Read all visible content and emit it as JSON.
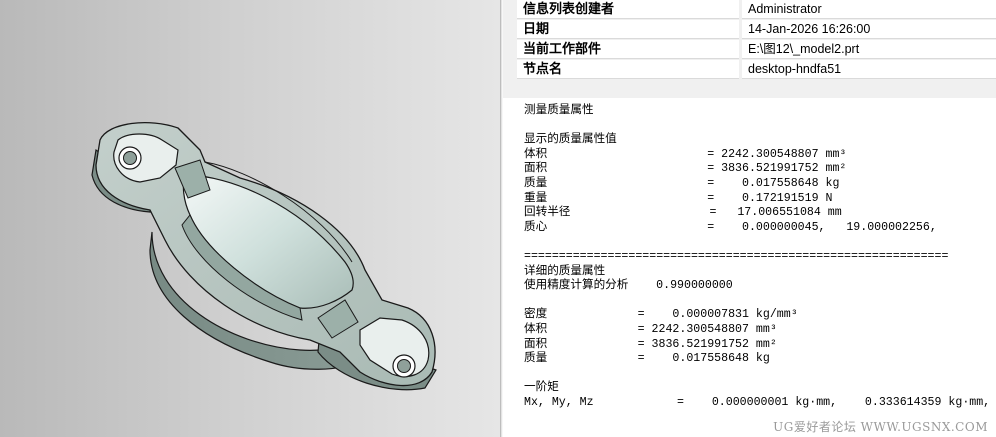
{
  "info_table": [
    {
      "key": "信息列表创建者",
      "value": "Administrator"
    },
    {
      "key": "日期",
      "value": "14-Jan-2026 16:26:00"
    },
    {
      "key": "当前工作部件",
      "value": "E:\\图12\\_model2.prt"
    },
    {
      "key": "节点名",
      "value": "desktop-hndfa51"
    }
  ],
  "report_lines": [
    "测量质量属性",
    "",
    "显示的质量属性值",
    "体积                       = 2242.300548807 mm³",
    "面积                       = 3836.521991752 mm²",
    "质量                       =    0.017558648 kg",
    "重量                       =    0.172191519 N",
    "回转半径                    =   17.006551084 mm",
    "质心                       =    0.000000045,   19.000002256,",
    "",
    "=============================================================",
    "详细的质量属性",
    "使用精度计算的分析    0.990000000",
    "",
    "密度             =    0.000007831 kg/mm³",
    "体积             = 2242.300548807 mm³",
    "面积             = 3836.521991752 mm²",
    "质量             =    0.017558648 kg",
    "",
    "一阶矩",
    "Mx, My, Mz            =    0.000000001 kg·mm,    0.333614359 kg·mm,",
    ""
  ],
  "watermark": "UG爱好者论坛 WWW.UGSNX.COM"
}
